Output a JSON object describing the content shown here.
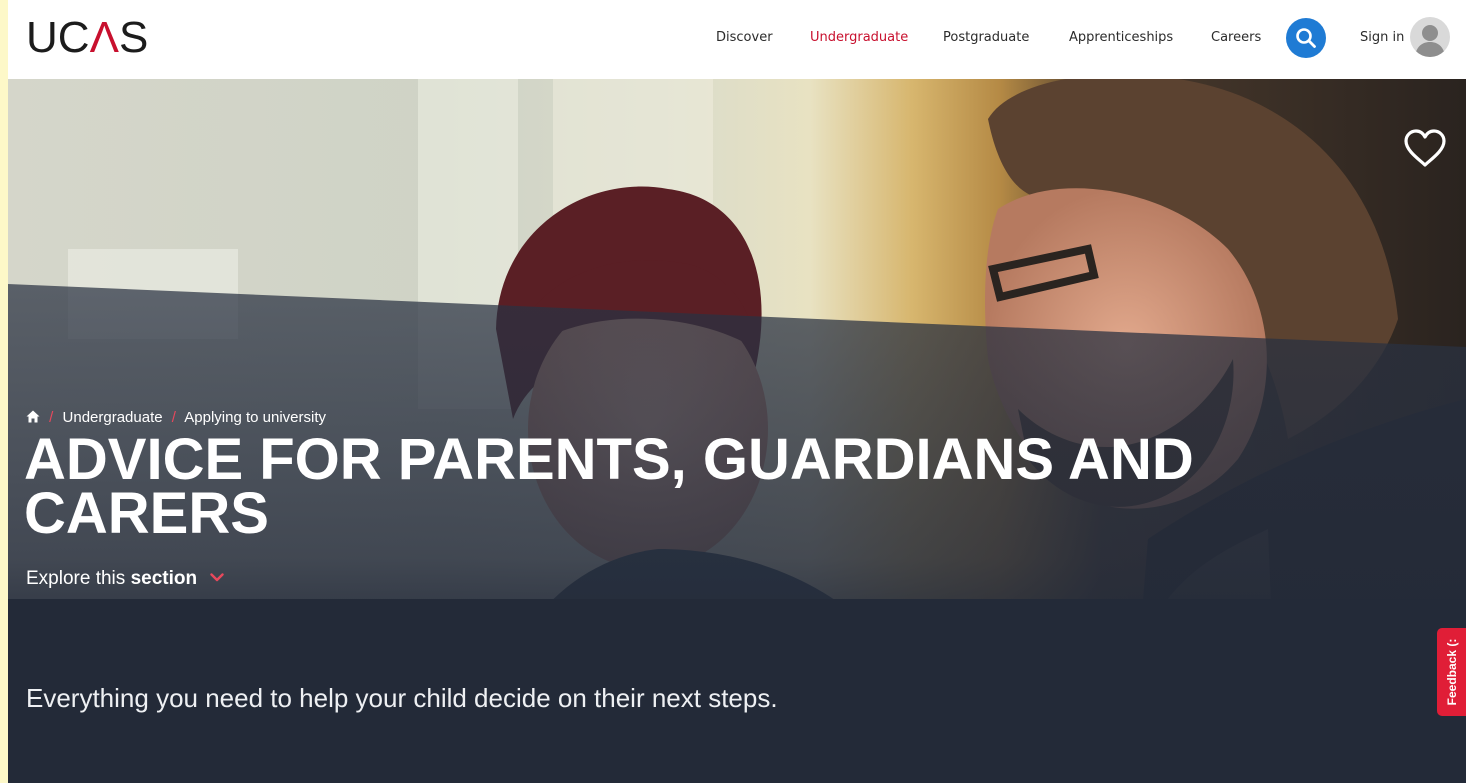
{
  "header": {
    "logo_text": "UCAS",
    "nav": [
      {
        "label": "Discover",
        "active": false
      },
      {
        "label": "Undergraduate",
        "active": true
      },
      {
        "label": "Postgraduate",
        "active": false
      },
      {
        "label": "Apprenticeships",
        "active": false
      },
      {
        "label": "Careers",
        "active": false
      }
    ],
    "search_icon": "search-icon",
    "signin_label": "Sign in",
    "avatar_icon": "user-avatar-icon",
    "accent_color": "#c8102e",
    "search_color": "#1f7bd4"
  },
  "hero": {
    "favourite_icon": "heart-outline-icon",
    "breadcrumb": {
      "home_icon": "home-icon",
      "items": [
        "Undergraduate",
        "Applying to university"
      ]
    },
    "title": "ADVICE FOR PARENTS, GUARDIANS AND CARERS",
    "explore_prefix": "Explore this",
    "explore_bold": "section",
    "explore_icon": "chevron-down-icon"
  },
  "lead_text": "Everything you need to help your child decide on their next steps.",
  "feedback_tab": {
    "label": "Feedback (:",
    "color": "#e01e37"
  }
}
